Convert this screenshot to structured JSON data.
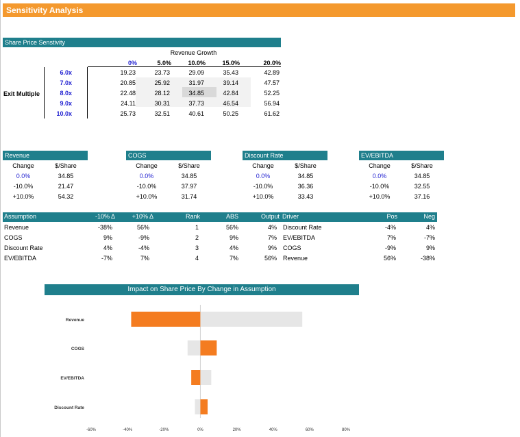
{
  "title": "Sensitivity Analysis",
  "sensitivity": {
    "header": "Share Price Senstivity",
    "col_title": "Revenue Growth",
    "row_title": "Exit Multiple",
    "cols": [
      "0%",
      "5.0%",
      "10.0%",
      "15.0%",
      "20.0%"
    ],
    "rows": [
      {
        "label": "6.0x",
        "values": [
          "19.23",
          "23.73",
          "29.09",
          "35.43",
          "42.89"
        ]
      },
      {
        "label": "7.0x",
        "values": [
          "20.85",
          "25.92",
          "31.97",
          "39.14",
          "47.57"
        ]
      },
      {
        "label": "8.0x",
        "values": [
          "22.48",
          "28.12",
          "34.85",
          "42.84",
          "52.25"
        ]
      },
      {
        "label": "9.0x",
        "values": [
          "24.11",
          "30.31",
          "37.73",
          "46.54",
          "56.94"
        ]
      },
      {
        "label": "10.0x",
        "values": [
          "25.73",
          "32.51",
          "40.61",
          "50.25",
          "61.62"
        ]
      }
    ]
  },
  "mini_tables": [
    {
      "title": "Revenue",
      "col1": "Change",
      "col2": "$/Share",
      "rows": [
        [
          "0.0%",
          "34.85"
        ],
        [
          "-10.0%",
          "21.47"
        ],
        [
          "+10.0%",
          "54.32"
        ]
      ]
    },
    {
      "title": "COGS",
      "col1": "Change",
      "col2": "$/Share",
      "rows": [
        [
          "0.0%",
          "34.85"
        ],
        [
          "-10.0%",
          "37.97"
        ],
        [
          "+10.0%",
          "31.74"
        ]
      ]
    },
    {
      "title": "Discount Rate",
      "col1": "Change",
      "col2": "$/Share",
      "rows": [
        [
          "0.0%",
          "34.85"
        ],
        [
          "-10.0%",
          "36.36"
        ],
        [
          "+10.0%",
          "33.43"
        ]
      ]
    },
    {
      "title": "EV/EBITDA",
      "col1": "Change",
      "col2": "$/Share",
      "rows": [
        [
          "0.0%",
          "34.85"
        ],
        [
          "-10.0%",
          "32.55"
        ],
        [
          "+10.0%",
          "37.16"
        ]
      ]
    }
  ],
  "assumption_table": {
    "headers": [
      "Assumption",
      "-10% Δ",
      "+10% Δ",
      "Rank",
      "ABS",
      "Output",
      "Driver",
      "Pos",
      "Neg"
    ],
    "rows": [
      [
        "Revenue",
        "-38%",
        "56%",
        "1",
        "56%",
        "4%",
        "Discount Rate",
        "-4%",
        "4%"
      ],
      [
        "COGS",
        "9%",
        "-9%",
        "2",
        "9%",
        "7%",
        "EV/EBITDA",
        "7%",
        "-7%"
      ],
      [
        "Discount Rate",
        "4%",
        "-4%",
        "3",
        "4%",
        "9%",
        "COGS",
        "-9%",
        "9%"
      ],
      [
        "EV/EBITDA",
        "-7%",
        "7%",
        "4",
        "7%",
        "56%",
        "Revenue",
        "56%",
        "-38%"
      ]
    ]
  },
  "chart_data": {
    "type": "bar",
    "orientation": "horizontal",
    "title": "Impact on Share Price By Change in Assumption",
    "categories": [
      "Revenue",
      "COGS",
      "EV/EBITDA",
      "Discount Rate"
    ],
    "series": [
      {
        "color": "#f47c20",
        "values": [
          -38,
          9,
          -5,
          4
        ]
      },
      {
        "color": "#e6e6e6",
        "values": [
          56,
          -7,
          6,
          -3
        ]
      }
    ],
    "x_ticks": [
      "-60%",
      "-40%",
      "-20%",
      "0%",
      "20%",
      "40%",
      "60%",
      "80%"
    ],
    "xlim": [
      -60,
      80
    ],
    "grid": false
  }
}
